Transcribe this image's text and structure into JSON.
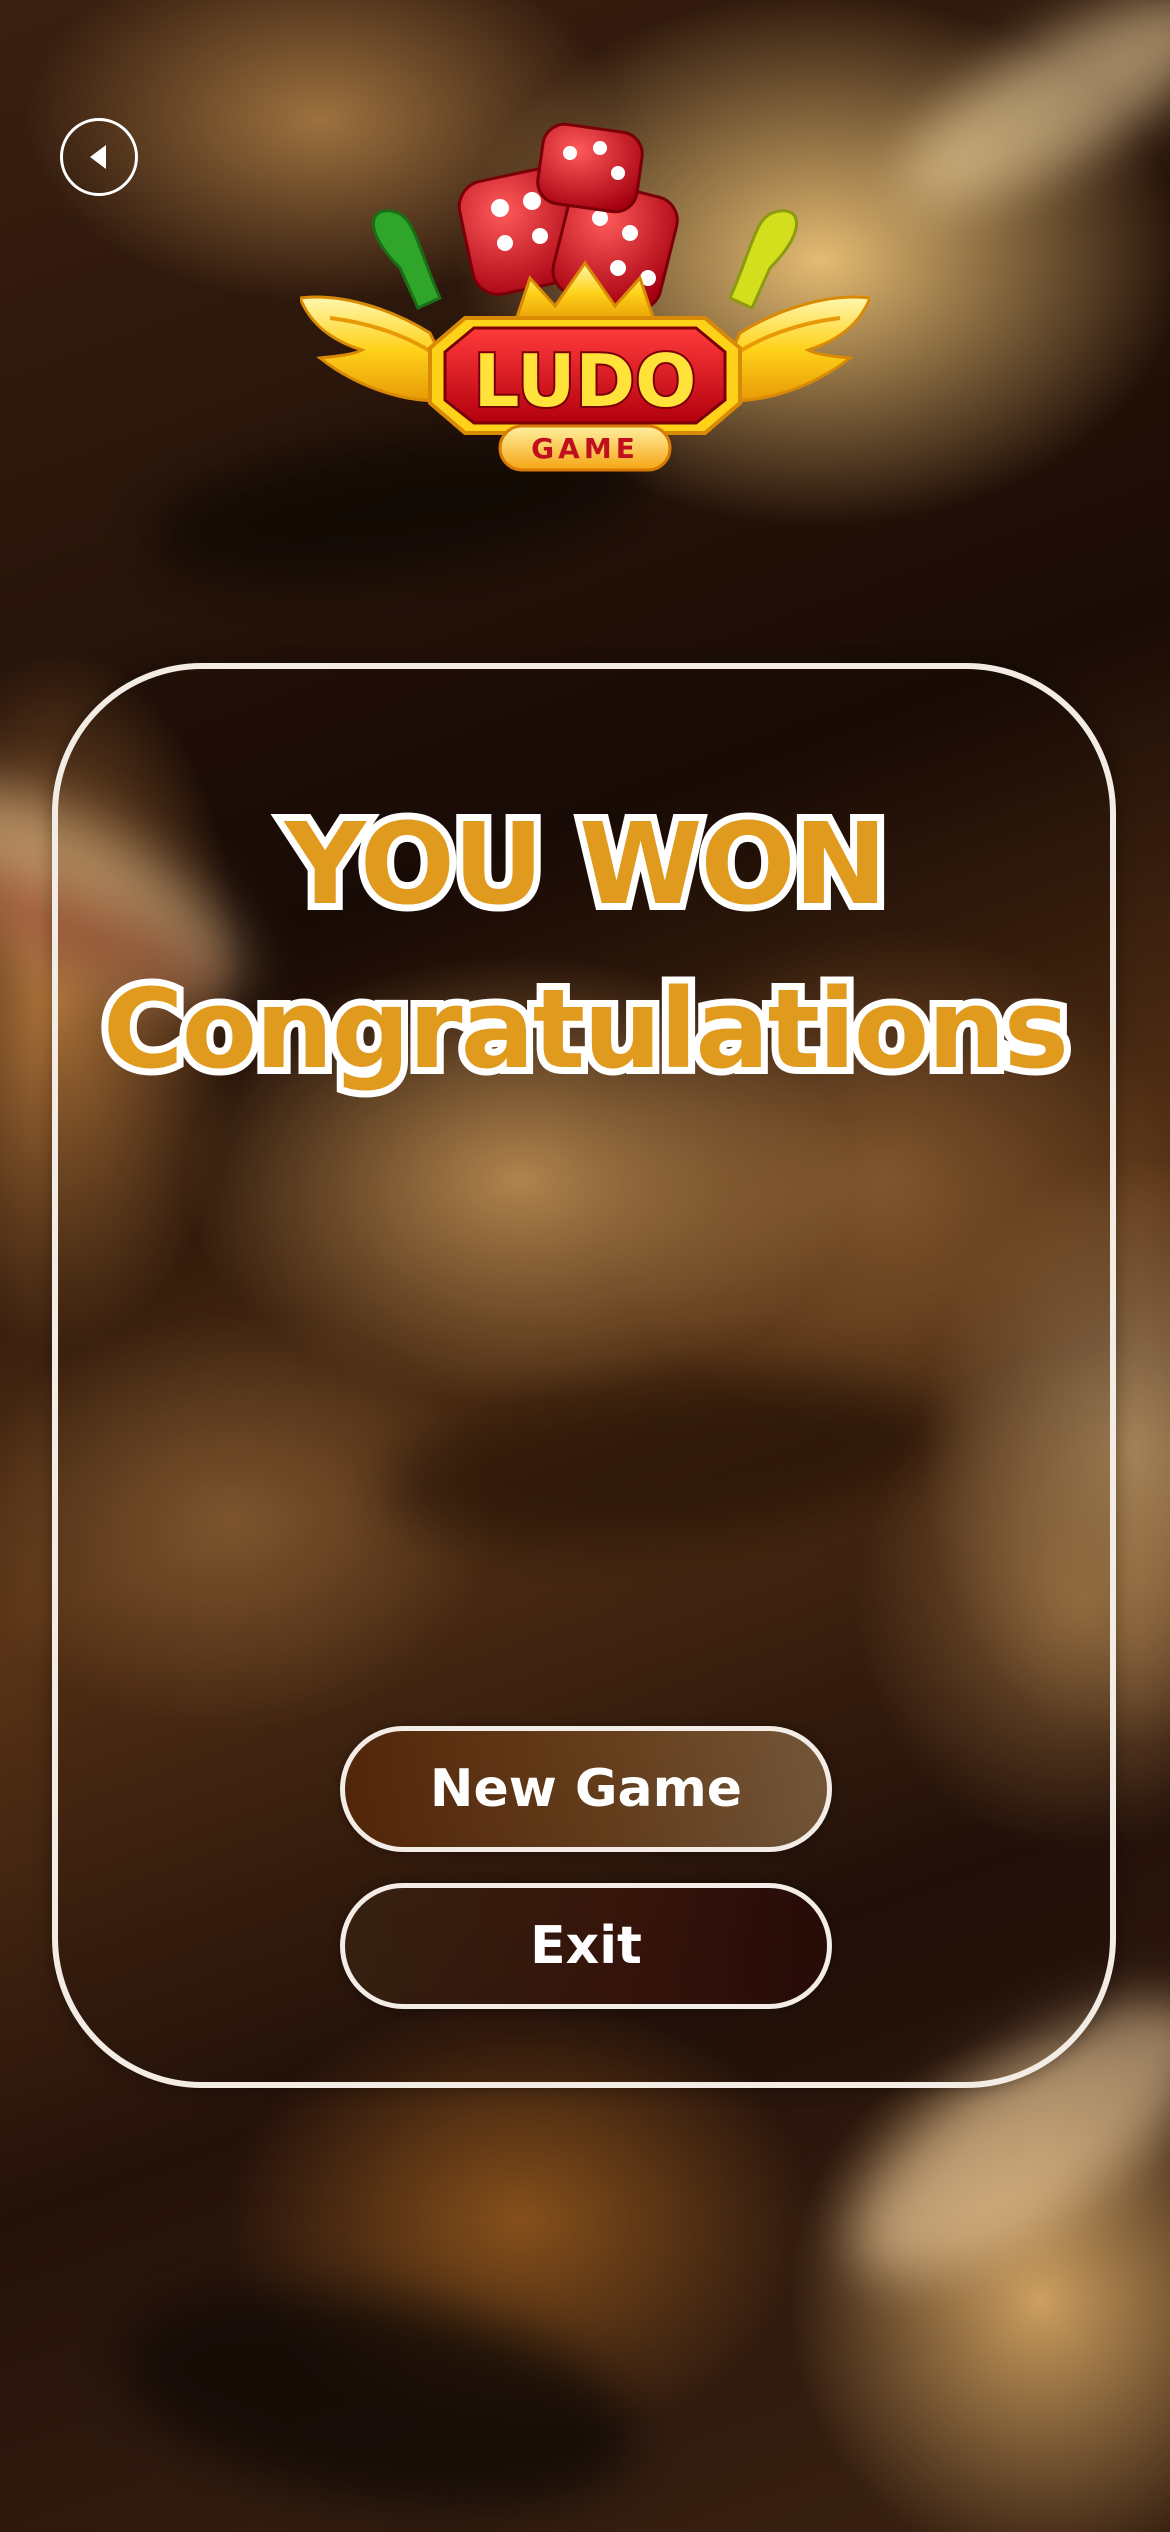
{
  "screen": {
    "back_icon": "back-arrow-icon",
    "logo": {
      "title": "LUDO",
      "subtitle": "GAME"
    },
    "result": {
      "headline": "YOU WON",
      "message": "Congratulations"
    },
    "buttons": {
      "new_game": "New Game",
      "exit": "Exit"
    },
    "colors": {
      "title_fill": "#e09a1e",
      "title_outline": "#ffffff",
      "panel_border": "#f3ece4"
    }
  }
}
